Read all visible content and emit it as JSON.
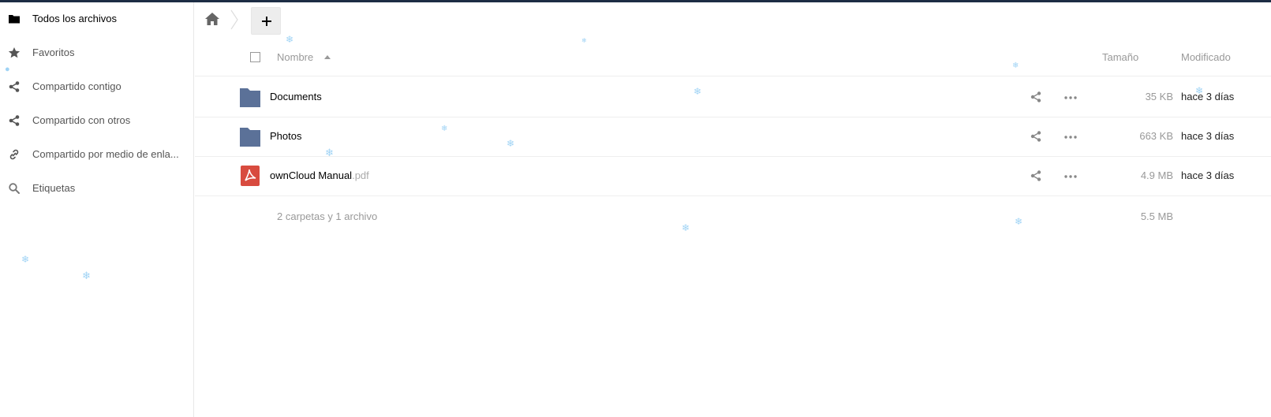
{
  "sidebar": {
    "items": [
      {
        "label": "Todos los archivos",
        "icon": "folder-icon",
        "active": true
      },
      {
        "label": "Favoritos",
        "icon": "star-icon"
      },
      {
        "label": "Compartido contigo",
        "icon": "share-icon"
      },
      {
        "label": "Compartido con otros",
        "icon": "share-icon"
      },
      {
        "label": "Compartido por medio de enla...",
        "icon": "link-icon"
      },
      {
        "label": "Etiquetas",
        "icon": "search-icon"
      }
    ]
  },
  "toolbar": {
    "home_icon": "home-icon",
    "new_icon": "plus-icon"
  },
  "table": {
    "headers": {
      "name": "Nombre",
      "size": "Tamaño",
      "modified": "Modificado"
    },
    "rows": [
      {
        "name": "Documents",
        "ext": "",
        "icon": "folder-icon",
        "size": "35 KB",
        "modified": "hace 3 días"
      },
      {
        "name": "Photos",
        "ext": "",
        "icon": "folder-icon",
        "size": "663 KB",
        "modified": "hace 3 días"
      },
      {
        "name": "ownCloud Manual",
        "ext": ".pdf",
        "icon": "pdf-icon",
        "size": "4.9 MB",
        "modified": "hace 3 días"
      }
    ],
    "summary": {
      "text": "2 carpetas y 1 archivo",
      "size": "5.5 MB"
    }
  },
  "colors": {
    "topbar": "#1d2d44",
    "folder": "#5b7198",
    "pdf": "#d84b3f",
    "snowflake": "#9fd3f5"
  }
}
